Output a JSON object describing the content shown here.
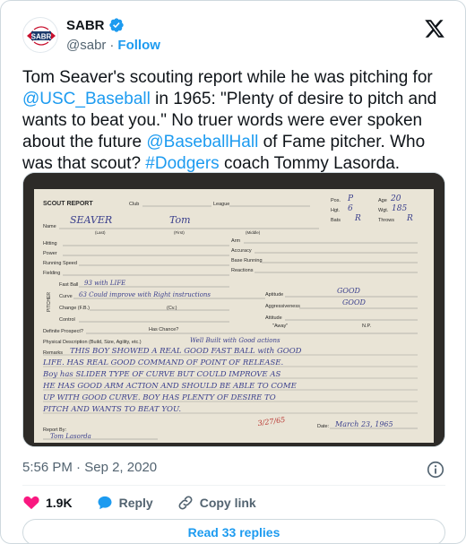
{
  "account": {
    "name": "SABR",
    "handle": "@sabr",
    "separator": "·",
    "follow_label": "Follow",
    "logo_text": "SABR"
  },
  "tweet": {
    "part1": "Tom Seaver's scouting report while he was pitching for ",
    "mention_usc": "@USC_Baseball",
    "part2": " in 1965: \"Plenty of desire to pitch and wants to beat you.\" No truer words were ever spoken about the future ",
    "mention_hall": "@BaseballHall",
    "part3": " of Fame pitcher. Who was that scout? ",
    "hashtag": "#Dodgers",
    "part4": " coach Tommy Lasorda."
  },
  "card": {
    "title": "SCOUT REPORT",
    "club_label": "Club",
    "league_label": "League",
    "pos_label": "Pos.",
    "pos_value": "P",
    "age_label": "Age",
    "age_value": "20",
    "hgt_label": "Hgt.",
    "hgt_value": "6",
    "wgt_label": "Wgt.",
    "wgt_value": "185",
    "bats_label": "Bats",
    "bats_value": "R",
    "throws_label": "Throws",
    "throws_value": "R",
    "name_label": "Name",
    "last_label": "(Last)",
    "first_label": "(First)",
    "middle_label": "(Middle)",
    "last_value": "SEAVER",
    "first_value": "Tom",
    "hitting": "Hitting",
    "power": "Power",
    "running": "Running Speed",
    "fielding": "Fielding",
    "arm": "Arm",
    "accuracy": "Accuracy",
    "base_running": "Base Running",
    "reactions": "Reactions",
    "pitcher": "PITCHER",
    "fastball": "Fast Ball",
    "fastball_value": "93 with LIFE",
    "curve": "Curve",
    "curve_value": "63 Could improve with Right instructions",
    "change": "Change (F.B.)",
    "cv": "(Cv.)",
    "control": "Control",
    "aptitude": "Aptitude",
    "aptitude_value": "GOOD",
    "aggressiveness": "Aggressiveness",
    "aggressiveness_value": "GOOD",
    "attitude": "Attitude",
    "definite": "Definite Prospect?",
    "has_chance": "Has Chance?",
    "away": "\"Away\"",
    "np": "N.P.",
    "physical": "Physical Description (Build, Size, Agility, etc.)",
    "physical_value": "Well Built with Good actions",
    "remarks": "Remarks",
    "remarks_lines": [
      "THIS BOY SHOWED A REAL GOOD FAST BALL with GOOD",
      "LIFE. HAS REAL GOOD COMMAND OF POINT OF RELEASE.",
      "Boy has SLIDER TYPE OF CURVE BUT COULD IMPROVE AS",
      "HE HAS GOOD ARM ACTION AND SHOULD BE ABLE TO COME",
      "UP WITH GOOD CURVE. BOY HAS PLENTY OF DESIRE TO",
      "PITCH AND WANTS TO BEAT YOU."
    ],
    "report_by": "Report By:",
    "report_by_value": "Tom Lasorda",
    "date_label": "Date:",
    "date_value": "March 23, 1965",
    "stamp": "3/27/65"
  },
  "meta": {
    "time": "5:56 PM",
    "date": "Sep 2, 2020",
    "dot": "·"
  },
  "actions": {
    "likes": "1.9K",
    "reply": "Reply",
    "copy_link": "Copy link"
  },
  "replies_button": "Read 33 replies",
  "colors": {
    "accent": "#1d9bf0",
    "like": "#f91880",
    "verified": "#1d9bf0",
    "card_bg": "#e9e4d6",
    "ink": "#3a3f8c"
  }
}
